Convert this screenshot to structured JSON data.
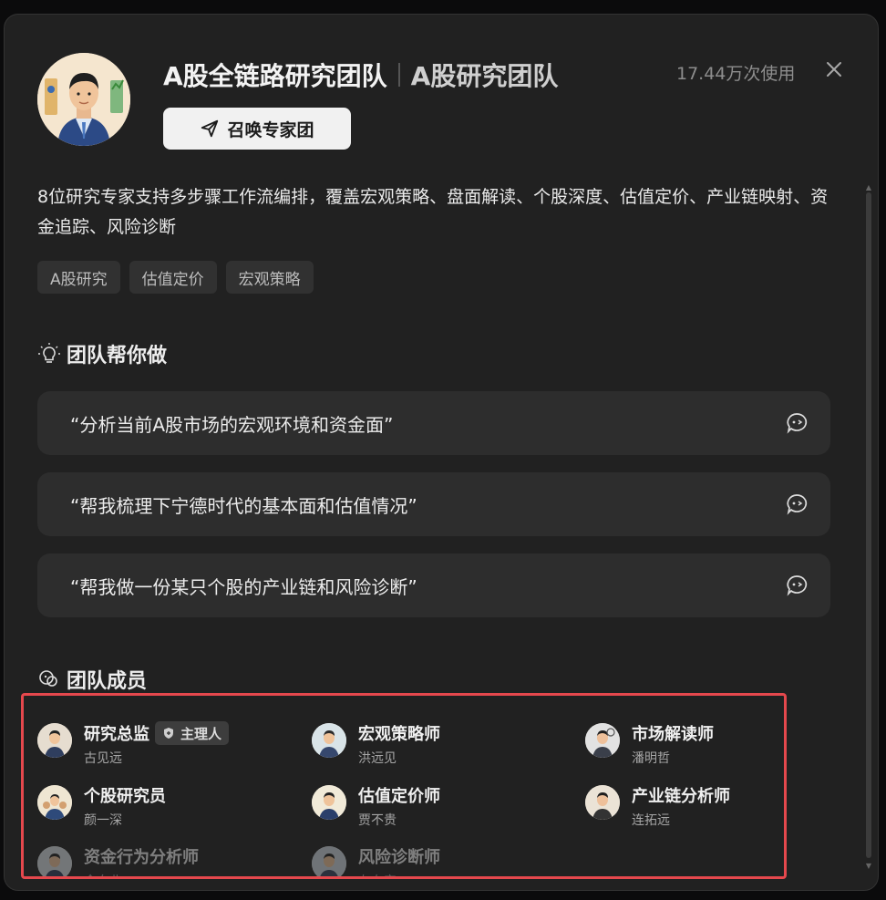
{
  "header": {
    "title": "A股全链路研究团队",
    "subtitle": "A股研究团队",
    "usage": "17.44万次使用",
    "summon_label": "召唤专家团"
  },
  "description": "8位研究专家支持多步骤工作流编排，覆盖宏观策略、盘面解读、个股深度、估值定价、产业链映射、资金追踪、风险诊断",
  "tags": [
    "A股研究",
    "估值定价",
    "宏观策略"
  ],
  "help_section": {
    "title": "团队帮你做",
    "prompts": [
      "“分析当前A股市场的宏观环境和资金面”",
      "“帮我梳理下宁德时代的基本面和估值情况”",
      "“帮我做一份某只个股的产业链和风险诊断”"
    ]
  },
  "members_section": {
    "title": "团队成员",
    "lead_badge": "主理人",
    "members": [
      {
        "role": "研究总监",
        "name": "古见远"
      },
      {
        "role": "宏观策略师",
        "name": "洪远见"
      },
      {
        "role": "市场解读师",
        "name": "潘明哲"
      },
      {
        "role": "个股研究员",
        "name": "颜一深"
      },
      {
        "role": "估值定价师",
        "name": "贾不贵"
      },
      {
        "role": "产业链分析师",
        "name": "连拓远"
      },
      {
        "role": "资金行为分析师",
        "name": "金向北"
      },
      {
        "role": "风险诊断师",
        "name": "左右安"
      }
    ]
  },
  "colors": {
    "background": "#212121",
    "card": "#2d2d2d",
    "highlight_border": "#e5484d",
    "button_bg": "#f1f1f1"
  }
}
